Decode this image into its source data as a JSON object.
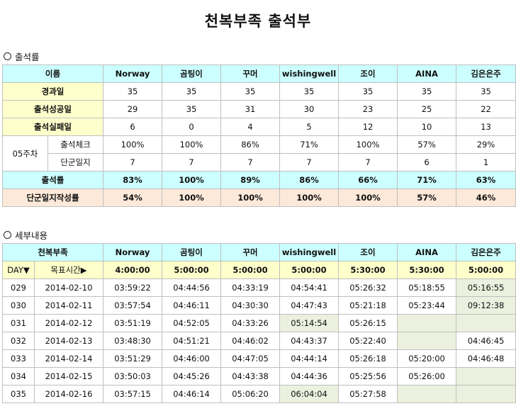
{
  "title": "천복부족 출석부",
  "section1": "출석률",
  "section2": "세부내용",
  "attendance": {
    "header_label": "이름",
    "names": [
      "Norway",
      "곰팅이",
      "꾸머",
      "wishingwell",
      "조이",
      "AINA",
      "김은은주"
    ],
    "rows": [
      {
        "label": "경과일",
        "values": [
          "35",
          "35",
          "35",
          "35",
          "35",
          "35",
          "35"
        ]
      },
      {
        "label": "출석성공일",
        "values": [
          "29",
          "35",
          "31",
          "30",
          "23",
          "25",
          "22"
        ]
      },
      {
        "label": "출석실패일",
        "values": [
          "6",
          "0",
          "4",
          "5",
          "12",
          "10",
          "13"
        ]
      }
    ],
    "week_label": "05주차",
    "week_rows": [
      {
        "label": "출석체크",
        "values": [
          "100%",
          "100%",
          "86%",
          "71%",
          "100%",
          "57%",
          "29%"
        ]
      },
      {
        "label": "단군일지",
        "values": [
          "7",
          "7",
          "7",
          "7",
          "7",
          "6",
          "1"
        ]
      }
    ],
    "rate": {
      "label": "출석률",
      "values": [
        "83%",
        "100%",
        "89%",
        "86%",
        "66%",
        "71%",
        "63%"
      ]
    },
    "journal_rate": {
      "label": "단군일지작성률",
      "values": [
        "54%",
        "100%",
        "100%",
        "100%",
        "100%",
        "57%",
        "46%"
      ]
    }
  },
  "detail": {
    "header_label": "천복부족",
    "names": [
      "Norway",
      "곰팅이",
      "꾸머",
      "wishingwell",
      "조이",
      "AINA",
      "김은은주"
    ],
    "day_label": "DAY▼",
    "target_label": "목표시간▶",
    "targets": [
      "4:00:00",
      "5:00:00",
      "5:00:00",
      "5:00:00",
      "5:30:00",
      "5:30:00",
      "5:00:00"
    ],
    "rows": [
      {
        "day": "029",
        "date": "2014-02-10",
        "times": [
          "03:59:22",
          "04:44:56",
          "04:33:19",
          "04:54:41",
          "05:26:32",
          "05:18:55",
          "05:16:55"
        ],
        "hl": [
          6
        ]
      },
      {
        "day": "030",
        "date": "2014-02-11",
        "times": [
          "03:57:54",
          "04:46:11",
          "04:30:30",
          "04:47:43",
          "05:21:18",
          "05:23:44",
          "09:12:38"
        ],
        "hl": [
          6
        ]
      },
      {
        "day": "031",
        "date": "2014-02-12",
        "times": [
          "03:51:19",
          "04:52:05",
          "04:33:26",
          "05:14:54",
          "05:26:15",
          "",
          ""
        ],
        "hl": [
          3,
          5,
          6
        ]
      },
      {
        "day": "032",
        "date": "2014-02-13",
        "times": [
          "03:48:30",
          "04:51:21",
          "04:46:02",
          "04:43:37",
          "05:22:40",
          "",
          "04:46:45"
        ],
        "hl": [
          5
        ]
      },
      {
        "day": "033",
        "date": "2014-02-14",
        "times": [
          "03:51:29",
          "04:46:00",
          "04:47:05",
          "04:44:14",
          "05:26:18",
          "05:20:00",
          "04:46:48"
        ],
        "hl": []
      },
      {
        "day": "034",
        "date": "2014-02-15",
        "times": [
          "03:50:03",
          "04:45:26",
          "04:43:38",
          "04:44:36",
          "05:25:56",
          "05:26:00",
          ""
        ],
        "hl": [
          6
        ]
      },
      {
        "day": "035",
        "date": "2014-02-16",
        "times": [
          "03:57:15",
          "04:46:14",
          "05:06:20",
          "06:04:04",
          "05:27:58",
          "",
          ""
        ],
        "hl": [
          3,
          5,
          6
        ]
      }
    ]
  }
}
